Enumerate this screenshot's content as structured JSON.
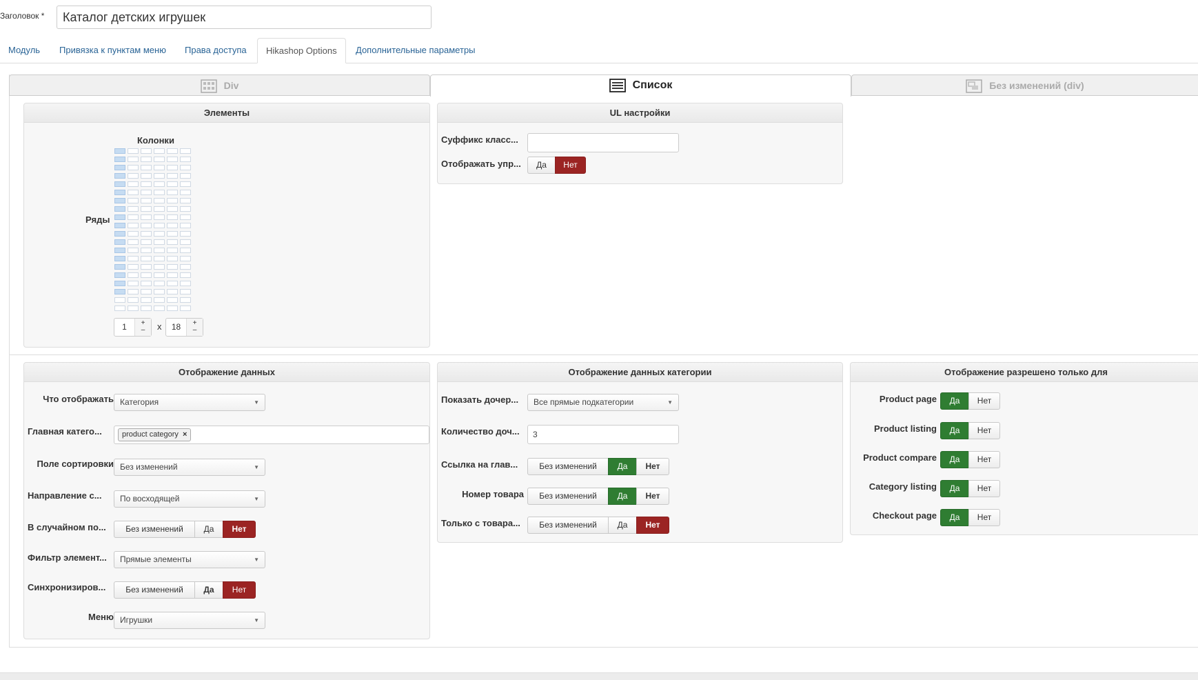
{
  "title_field": {
    "label": "Заголовок *",
    "value": "Каталог детских игрушек"
  },
  "tabs": [
    {
      "label": "Модуль"
    },
    {
      "label": "Привязка к пунктам меню"
    },
    {
      "label": "Права доступа"
    },
    {
      "label": "Hikashop Options"
    },
    {
      "label": "Дополнительные параметры"
    }
  ],
  "active_tab": "Hikashop Options",
  "layout_tabs": [
    {
      "label": "Div",
      "icon": "grid-layout-icon"
    },
    {
      "label": "Список",
      "icon": "list-layout-icon"
    },
    {
      "label": "Без изменений (div)",
      "icon": "inherit-layout-icon"
    }
  ],
  "elements_panel": {
    "title": "Элементы",
    "columns_label": "Колонки",
    "rows_label": "Ряды",
    "columns_value": "1",
    "times": "x",
    "rows_value": "18",
    "plus": "+",
    "minus": "–"
  },
  "ul_panel": {
    "title": "UL настройки",
    "suffix_label": "Суффикс класс...",
    "suffix_value": "",
    "display_label": "Отображать упр...",
    "yes": "Да",
    "no": "Нет"
  },
  "data_display_panel": {
    "title": "Отображение данных",
    "what_label": "Что отображать",
    "what_value": "Категория",
    "main_cat_label": "Главная катего...",
    "main_cat_tag": "product category",
    "tag_remove": "×",
    "sort_field_label": "Поле сортировки",
    "sort_field_value": "Без изменений",
    "direction_label": "Направление с...",
    "direction_value": "По восходящей",
    "random_label": "В случайном по...",
    "filter_label": "Фильтр элемент...",
    "filter_value": "Прямые элементы",
    "sync_label": "Синхронизиров...",
    "menu_label": "Меню",
    "menu_value": "Игрушки",
    "no_change": "Без изменений",
    "yes": "Да",
    "no": "Нет"
  },
  "category_panel": {
    "title": "Отображение данных категории",
    "show_children_label": "Показать дочер...",
    "show_children_value": "Все прямые подкатегории",
    "children_count_label": "Количество доч...",
    "children_count_value": "3",
    "link_main_label": "Ссылка на глав...",
    "item_number_label": "Номер товара",
    "only_with_label": "Только с товара...",
    "no_change": "Без изменений",
    "yes": "Да",
    "no": "Нет"
  },
  "allowed_panel": {
    "title": "Отображение разрешено только для",
    "rows": [
      {
        "label": "Product page"
      },
      {
        "label": "Product listing"
      },
      {
        "label": "Product compare"
      },
      {
        "label": "Category listing"
      },
      {
        "label": "Checkout page"
      }
    ],
    "yes": "Да",
    "no": "Нет"
  },
  "grid": {
    "columns": 6,
    "rows": 20,
    "selected_columns": 1,
    "selected_rows": 18
  },
  "colors": {
    "red": "#9b2423",
    "green": "#2f7d32",
    "link": "#2a6496",
    "grid_selected": "#c6dcf2"
  }
}
